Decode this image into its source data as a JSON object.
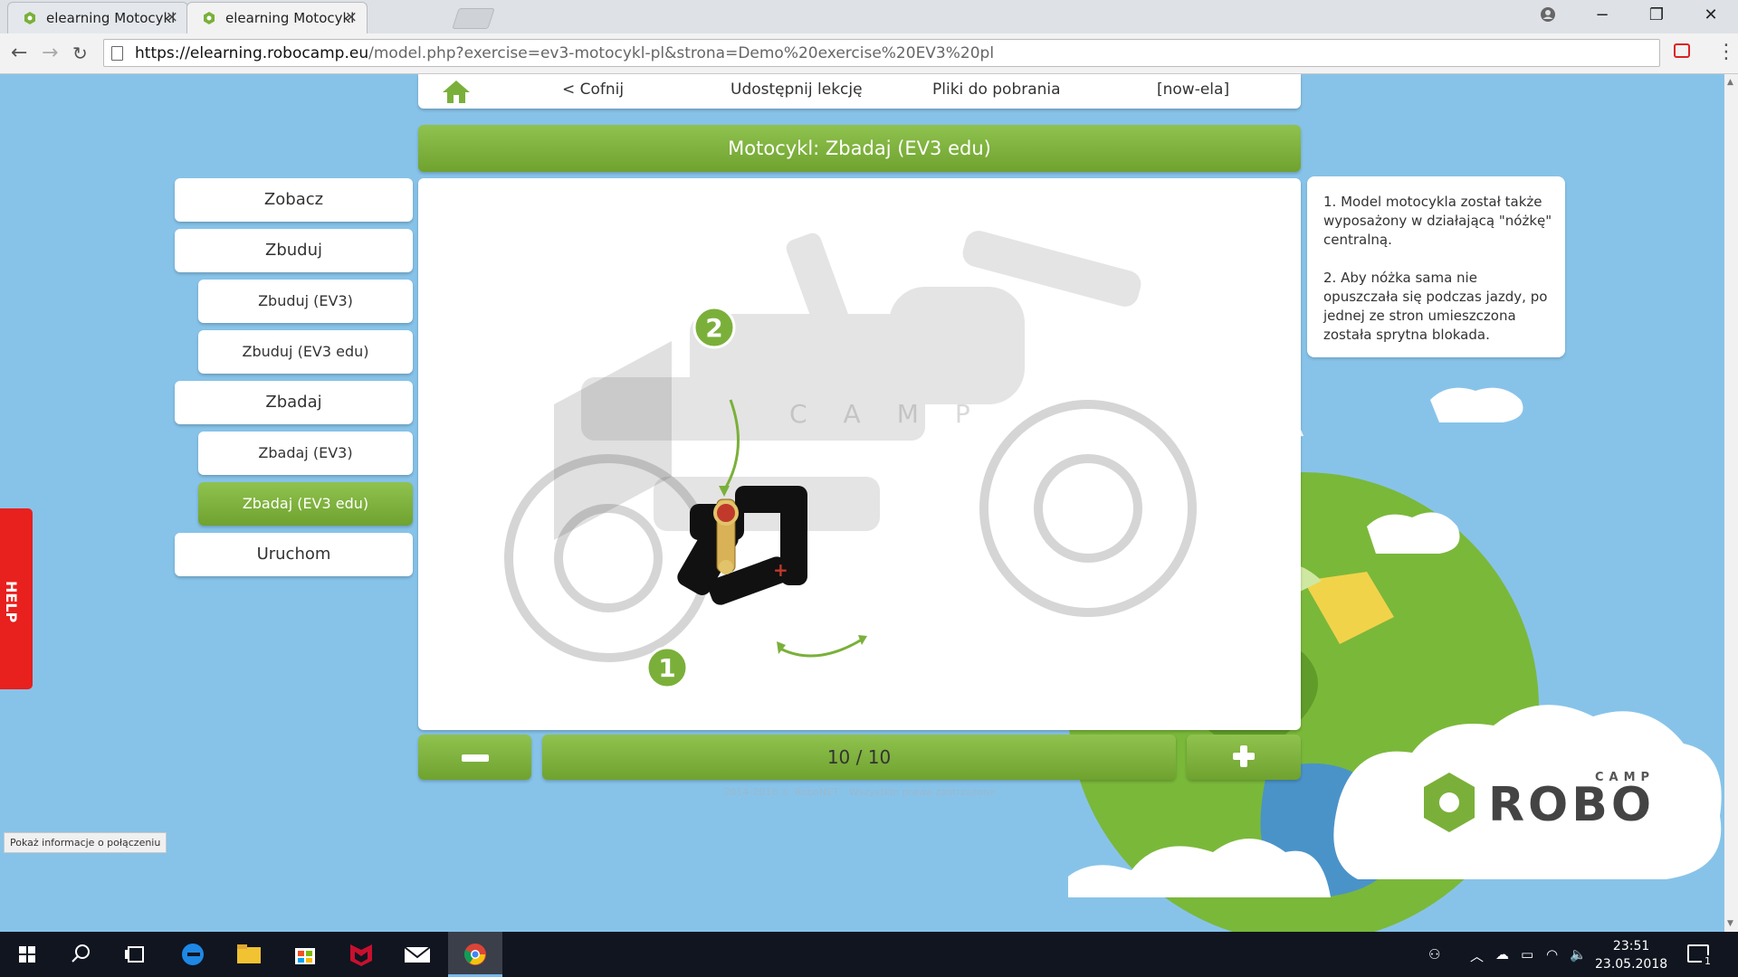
{
  "browser": {
    "tabs": [
      {
        "title": "elearning Motocykl",
        "active": false
      },
      {
        "title": "elearning Motocykl",
        "active": true
      }
    ],
    "url_host": "https://elearning.robocamp.eu",
    "url_path": "/model.php?exercise=ev3-motocykl-pl&strona=Demo%20exercise%20EV3%20pl",
    "status_tip": "Pokaż informacje o połączeniu"
  },
  "nav": {
    "back": "< Cofnij",
    "share": "Udostępnij lekcję",
    "downloads": "Pliki do pobrania",
    "user": "[now-ela]"
  },
  "page_title": "Motocykl: Zbadaj (EV3 edu)",
  "sidebar": {
    "items": [
      {
        "label": "Zobacz",
        "level": 1,
        "active": false
      },
      {
        "label": "Zbuduj",
        "level": 1,
        "active": false
      },
      {
        "label": "Zbuduj (EV3)",
        "level": 2,
        "active": false
      },
      {
        "label": "Zbuduj (EV3 edu)",
        "level": 2,
        "active": false
      },
      {
        "label": "Zbadaj",
        "level": 1,
        "active": false
      },
      {
        "label": "Zbadaj (EV3)",
        "level": 2,
        "active": false
      },
      {
        "label": "Zbadaj (EV3 edu)",
        "level": 2,
        "active": true
      },
      {
        "label": "Uruchom",
        "level": 1,
        "active": false
      }
    ]
  },
  "info": {
    "p1": "1. Model motocykla został także wyposażony w działającą \"nóżkę\" centralną.",
    "p2": "2. Aby nóżka sama nie opuszczała się podczas jazdy, po jednej ze stron umieszczona została sprytna blokada."
  },
  "diagram": {
    "marker1": "1",
    "marker2": "2"
  },
  "help_label": "HELP",
  "pager": {
    "text": "10 / 10",
    "minus": "−",
    "plus": "+"
  },
  "copyright": "2014-2016 © RoboNET : Wszystkie prawa zastrzeżone",
  "logo": {
    "small": "CAMP",
    "big": "ROBO"
  },
  "taskbar": {
    "time": "23:51",
    "date": "23.05.2018",
    "notif_count": "1"
  },
  "colors": {
    "accent_green": "#7ab03a",
    "sky": "#87c3e9",
    "help_red": "#e8201e"
  }
}
